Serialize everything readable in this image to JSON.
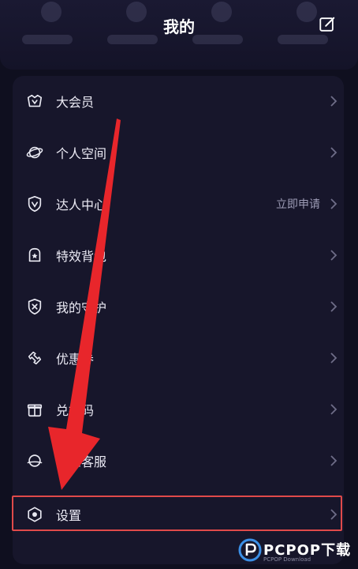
{
  "header": {
    "title": "我的",
    "edit_icon": "edit-icon"
  },
  "menu": {
    "items": [
      {
        "label": "大会员",
        "icon": "vip-crown-icon"
      },
      {
        "label": "个人空间",
        "icon": "planet-icon"
      },
      {
        "label": "达人中心",
        "icon": "verified-v-icon",
        "extra": "立即申请"
      },
      {
        "label": "特效背包",
        "icon": "backpack-icon"
      },
      {
        "label": "我的守护",
        "icon": "shield-icon"
      },
      {
        "label": "优惠券",
        "icon": "coupon-icon"
      },
      {
        "label": "兑换码",
        "icon": "gift-icon"
      },
      {
        "label": "联系客服",
        "icon": "headset-icon"
      },
      {
        "label": "设置",
        "icon": "settings-hexagon-icon"
      }
    ]
  },
  "colors": {
    "background": "#0f0f1f",
    "card": "#17162b",
    "highlight": "#e04a4a",
    "arrow": "#e8262b"
  },
  "watermark": {
    "brand": "PCPOP下载",
    "sub": "PCPOP Download"
  }
}
